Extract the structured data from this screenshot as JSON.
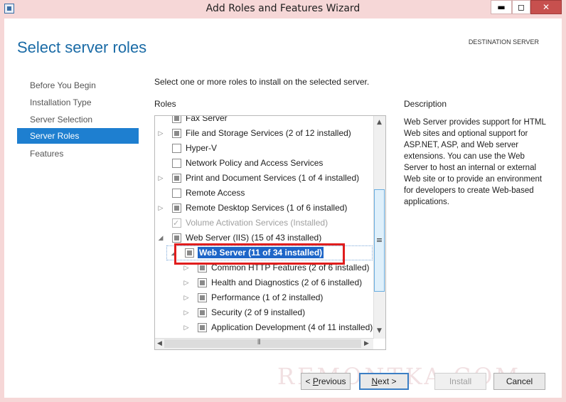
{
  "window": {
    "title": "Add Roles and Features Wizard",
    "minimize": "▬",
    "maximize": "◻",
    "close": "✕"
  },
  "header": {
    "page_title": "Select server roles",
    "destination_label": "DESTINATION SERVER"
  },
  "nav": {
    "items": [
      {
        "label": "Before You Begin",
        "active": false
      },
      {
        "label": "Installation Type",
        "active": false
      },
      {
        "label": "Server Selection",
        "active": false
      },
      {
        "label": "Server Roles",
        "active": true
      },
      {
        "label": "Features",
        "active": false
      }
    ]
  },
  "main": {
    "intro": "Select one or more roles to install on the selected server.",
    "roles_label": "Roles",
    "description_label": "Description",
    "description_text": "Web Server provides support for HTML Web sites and optional support for ASP.NET, ASP, and Web server extensions. You can use the Web Server to host an internal or external Web site or to provide an environment for developers to create Web-based applications."
  },
  "roles": [
    {
      "label": "Fax Server",
      "state": "partial_hidden"
    },
    {
      "label": "File and Storage Services (2 of 12 installed)",
      "state": "partial",
      "expand": "collapsed"
    },
    {
      "label": "Hyper-V",
      "state": "unchecked"
    },
    {
      "label": "Network Policy and Access Services",
      "state": "unchecked"
    },
    {
      "label": "Print and Document Services (1 of 4 installed)",
      "state": "partial",
      "expand": "collapsed"
    },
    {
      "label": "Remote Access",
      "state": "unchecked"
    },
    {
      "label": "Remote Desktop Services (1 of 6 installed)",
      "state": "partial",
      "expand": "collapsed"
    },
    {
      "label": "Volume Activation Services (Installed)",
      "state": "checked_disabled"
    },
    {
      "label": "Web Server (IIS) (15 of 43 installed)",
      "state": "partial",
      "expand": "expanded"
    },
    {
      "label": "Web Server (11 of 34 installed)",
      "state": "partial",
      "expand": "expanded",
      "selected": true
    },
    {
      "label": "Common HTTP Features (2 of 6 installed)",
      "state": "partial",
      "expand": "collapsed"
    },
    {
      "label": "Health and Diagnostics (2 of 6 installed)",
      "state": "partial",
      "expand": "collapsed"
    },
    {
      "label": "Performance (1 of 2 installed)",
      "state": "partial",
      "expand": "collapsed"
    },
    {
      "label": "Security (2 of 9 installed)",
      "state": "partial",
      "expand": "collapsed"
    },
    {
      "label": "Application Development (4 of 11 installed)",
      "state": "partial",
      "expand": "collapsed"
    }
  ],
  "buttons": {
    "previous_pre": "< ",
    "previous_key": "P",
    "previous_post": "revious",
    "next_key": "N",
    "next_post": "ext >",
    "install": "Install",
    "cancel": "Cancel"
  },
  "watermark": "REMONTKA.COM",
  "colors": {
    "accent": "#1e7fd0",
    "title_blue": "#1a6ba6",
    "highlight_red": "#e01d1d",
    "titlebar": "#f6d7d7"
  }
}
